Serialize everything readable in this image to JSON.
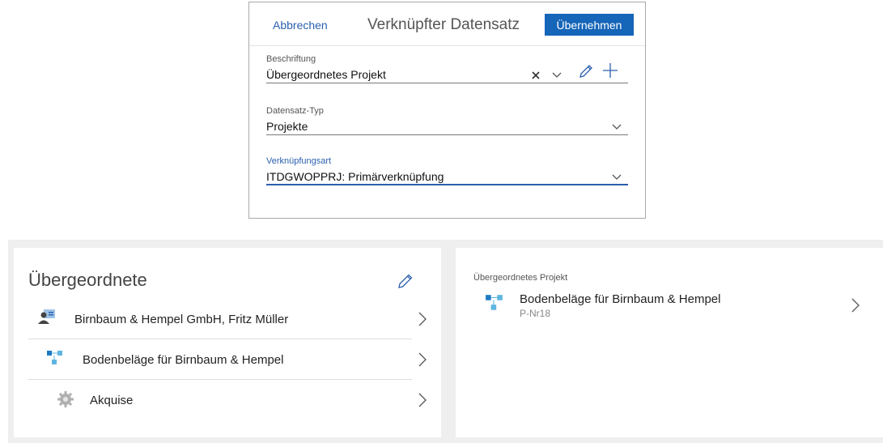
{
  "dialog": {
    "cancel_label": "Abbrechen",
    "title": "Verknüpfter Datensatz",
    "apply_label": "Übernehmen",
    "fields": [
      {
        "label": "Beschriftung",
        "value": "Übergeordnetes Projekt"
      },
      {
        "label": "Datensatz-Typ",
        "value": "Projekte"
      },
      {
        "label": "Verknüpfungsart",
        "value": "ITDGWOPPRJ: Primärverknüpfung"
      }
    ],
    "accent_color": "#1565b8"
  },
  "left_card": {
    "title": "Übergeordnete",
    "items": [
      {
        "label": "Birnbaum & Hempel GmbH, Fritz Müller",
        "icon": "contact-card-icon"
      },
      {
        "label": "Bodenbeläge für Birnbaum & Hempel",
        "icon": "project-hierarchy-icon"
      },
      {
        "label": "Akquise",
        "icon": "gear-icon"
      }
    ]
  },
  "right_card": {
    "label": "Übergeordnetes Projekt",
    "title": "Bodenbeläge für Birnbaum & Hempel",
    "subtitle": "P-Nr18",
    "icon": "project-hierarchy-icon"
  }
}
